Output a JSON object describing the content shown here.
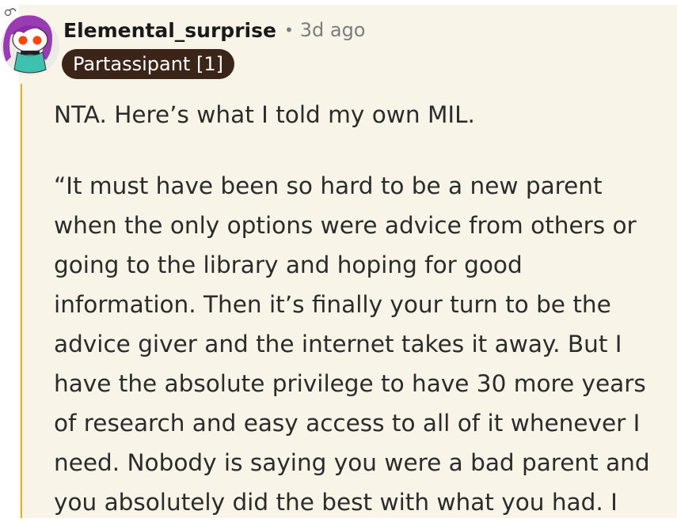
{
  "comment": {
    "username": "Elemental_surprise",
    "separator": "•",
    "time_ago": "3d ago",
    "flair": "Partassipant [1]",
    "paragraphs": [
      [
        "NTA. Here’s what I told my own MIL."
      ],
      [
        "“It must have been so hard to be a new parent",
        "when the only options were advice from others or",
        "going to the library and hoping for good",
        "information. Then it’s finally your turn to be the",
        "advice giver and the internet takes it away. But I",
        "have the absolute privilege to have 30 more years",
        "of research and easy access to all of it whenever I",
        "need. Nobody is saying you were a bad parent and",
        "you absolutely did the best with what you had. I"
      ]
    ]
  },
  "colors": {
    "comment_background": "#f9f4e8",
    "thread_line": "#d8b32a",
    "flair_background": "#3b2418",
    "avatar_hair": "#9b3bb3",
    "avatar_eyes": "#ff4500"
  },
  "icons": {
    "avatar": "snoo-avatar-icon"
  }
}
